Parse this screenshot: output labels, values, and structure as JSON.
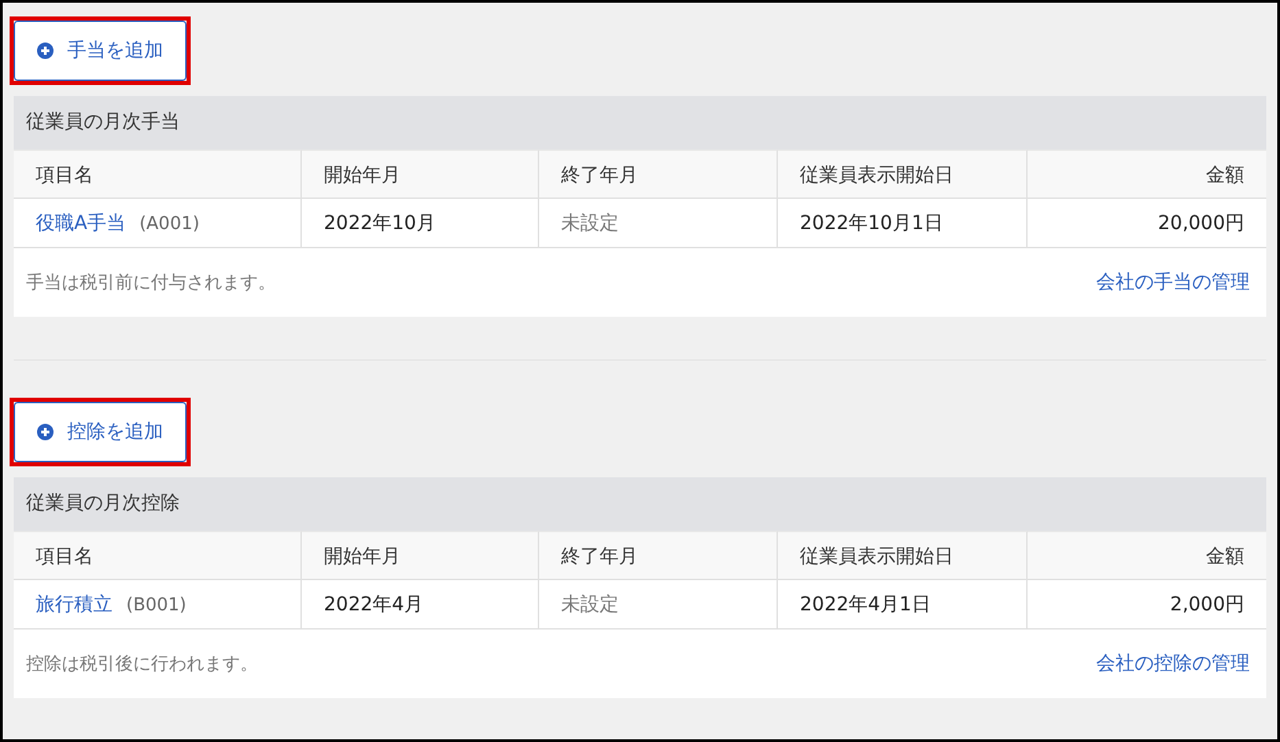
{
  "sections": [
    {
      "add_button": {
        "label": "手当を追加",
        "highlighted": true
      },
      "title": "従業員の月次手当",
      "columns": [
        "項目名",
        "開始年月",
        "終了年月",
        "従業員表示開始日",
        "金額"
      ],
      "rows": [
        {
          "cells": [
            {
              "text": "役職A手当",
              "code": "(A001)",
              "kind": "item"
            },
            {
              "text": "2022年10月",
              "kind": "value"
            },
            {
              "text": "未設定",
              "kind": "muted"
            },
            {
              "text": "2022年10月1日",
              "kind": "value"
            },
            {
              "text": "20,000円",
              "kind": "value"
            }
          ]
        }
      ],
      "note": "手当は税引前に付与されます。",
      "link": "会社の手当の管理"
    },
    {
      "add_button": {
        "label": "控除を追加",
        "highlighted": true
      },
      "title": "従業員の月次控除",
      "columns": [
        "項目名",
        "開始年月",
        "終了年月",
        "従業員表示開始日",
        "金額"
      ],
      "rows": [
        {
          "cells": [
            {
              "text": "旅行積立",
              "code": "(B001)",
              "kind": "item"
            },
            {
              "text": "2022年4月",
              "kind": "value"
            },
            {
              "text": "未設定",
              "kind": "muted"
            },
            {
              "text": "2022年4月1日",
              "kind": "value"
            },
            {
              "text": "2,000円",
              "kind": "value"
            }
          ]
        }
      ],
      "note": "控除は税引後に行われます。",
      "link": "会社の控除の管理"
    }
  ]
}
